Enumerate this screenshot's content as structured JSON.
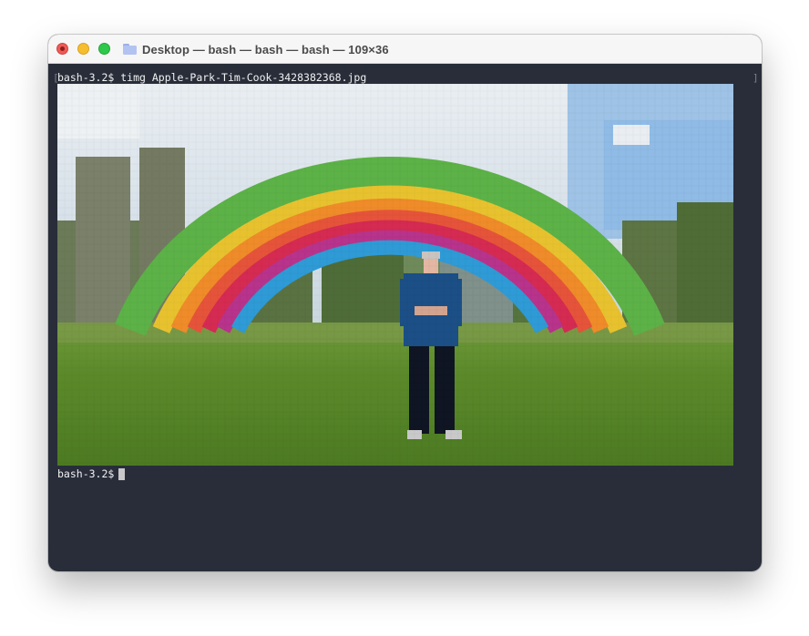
{
  "window": {
    "title": "Desktop — bash — bash — bash — 109×36",
    "title_icon": "folder-icon"
  },
  "terminal": {
    "line1_prompt": "bash-3.2$",
    "line1_command": "timg Apple-Park-Tim-Cook-3428382368.jpg",
    "line2_prompt": "bash-3.2$",
    "left_bracket": "[",
    "right_bracket": "]"
  },
  "colors": {
    "terminal_background": "#282d39",
    "titlebar_background": "#f7f6f6",
    "close": "#ee5b57",
    "minimize": "#f6bd2f",
    "maximize": "#2fc84a"
  }
}
